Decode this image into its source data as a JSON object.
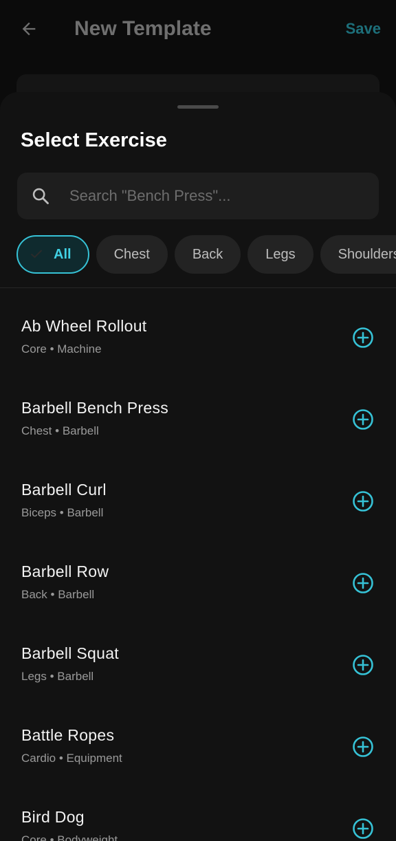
{
  "appbar": {
    "title": "New Template",
    "save_label": "Save",
    "back_icon": "arrow-left-icon"
  },
  "sheet": {
    "title": "Select Exercise",
    "search": {
      "placeholder": "Search \"Bench Press\"...",
      "value": "",
      "icon": "search-icon"
    },
    "filters": [
      {
        "label": "All",
        "selected": true
      },
      {
        "label": "Chest",
        "selected": false
      },
      {
        "label": "Back",
        "selected": false
      },
      {
        "label": "Legs",
        "selected": false
      },
      {
        "label": "Shoulders",
        "selected": false
      }
    ],
    "exercises": [
      {
        "name": "Ab Wheel Rollout",
        "muscle": "Core",
        "equipment": "Machine"
      },
      {
        "name": "Barbell Bench Press",
        "muscle": "Chest",
        "equipment": "Barbell"
      },
      {
        "name": "Barbell Curl",
        "muscle": "Biceps",
        "equipment": "Barbell"
      },
      {
        "name": "Barbell Row",
        "muscle": "Back",
        "equipment": "Barbell"
      },
      {
        "name": "Barbell Squat",
        "muscle": "Legs",
        "equipment": "Barbell"
      },
      {
        "name": "Battle Ropes",
        "muscle": "Cardio",
        "equipment": "Equipment"
      },
      {
        "name": "Bird Dog",
        "muscle": "Core",
        "equipment": "Bodyweight"
      }
    ],
    "meta_separator": " • "
  },
  "colors": {
    "accent": "#36c2d6",
    "background": "#121212",
    "chip_background": "#232323"
  }
}
